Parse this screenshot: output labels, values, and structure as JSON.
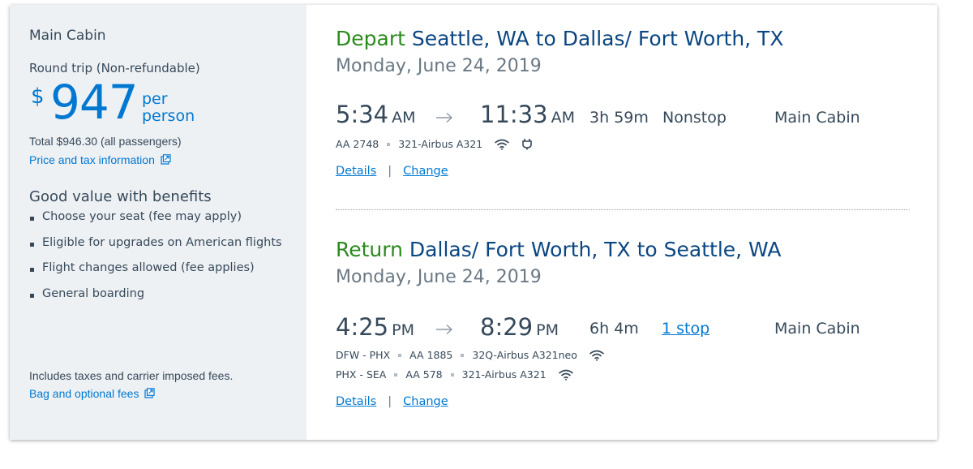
{
  "fare": {
    "cabin_title": "Main Cabin",
    "trip_type": "Round trip (Non-refundable)",
    "currency": "$",
    "amount": "947",
    "per_line1": "per",
    "per_line2": "person",
    "total": "Total $946.30 (all passengers)",
    "price_tax_link": "Price and tax information",
    "benefits_title": "Good value with benefits",
    "benefits": [
      "Choose your seat (fee may apply)",
      "Eligible for upgrades on American flights",
      "Flight changes allowed (fee applies)",
      "General boarding"
    ],
    "fees_note": "Includes taxes and carrier imposed fees.",
    "bag_fees_link": "Bag and optional fees"
  },
  "depart": {
    "label": "Depart",
    "route": "Seattle, WA to Dallas/ Fort Worth, TX",
    "date": "Monday, June 24, 2019",
    "dep_time": "5:34",
    "dep_ampm": "AM",
    "arr_time": "11:33",
    "arr_ampm": "AM",
    "dur_h": "3h",
    "dur_m": "59m",
    "stops": "Nonstop",
    "cabin": "Main Cabin",
    "flights": [
      {
        "flight": "AA 2748",
        "aircraft": "321-Airbus A321"
      }
    ],
    "details_label": "Details",
    "separator": "|",
    "change_label": "Change"
  },
  "return": {
    "label": "Return",
    "route": "Dallas/ Fort Worth, TX to Seattle, WA",
    "date": "Monday, June 24, 2019",
    "dep_time": "4:25",
    "dep_ampm": "PM",
    "arr_time": "8:29",
    "arr_ampm": "PM",
    "dur_h": "6h",
    "dur_m": "4m",
    "stops": "1 stop",
    "cabin": "Main Cabin",
    "flights": [
      {
        "route": "DFW - PHX",
        "flight": "AA 1885",
        "aircraft": "32Q-Airbus A321neo"
      },
      {
        "route": "PHX - SEA",
        "flight": "AA 578",
        "aircraft": "321-Airbus A321"
      }
    ],
    "details_label": "Details",
    "separator": "|",
    "change_label": "Change"
  },
  "colors": {
    "accent_blue": "#0078d2",
    "heading_navy": "#0b4682",
    "direction_green": "#2b8a1d",
    "panel_gray": "#eef1f4"
  }
}
